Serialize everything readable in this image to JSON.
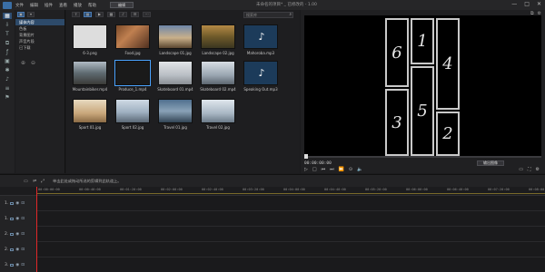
{
  "titlebar": {
    "menu": [
      "文件",
      "编辑",
      "插件",
      "查看",
      "播放",
      "帮助"
    ],
    "mode_button": "编辑",
    "window_title": "未命名的项目* _ 已修改的 - 1.00",
    "controls": [
      "—",
      "□",
      "✕"
    ]
  },
  "rail": {
    "icons": [
      "media-room-icon",
      "import-icon",
      "text-icon",
      "transition-icon",
      "fx-icon",
      "pip-icon",
      "particle-icon",
      "audio-icon",
      "subtitle-icon",
      "chapter-icon"
    ]
  },
  "tree": {
    "items": [
      "媒体内容",
      "色板",
      "背景图片",
      "声音片段",
      "已下载"
    ],
    "selected_index": 0
  },
  "library": {
    "search_placeholder": "搜索库",
    "items": [
      {
        "name": "6-3.png",
        "thumb": "t-collage",
        "type": "image"
      },
      {
        "name": "Food.jpg",
        "thumb": "t-food",
        "type": "image"
      },
      {
        "name": "Landscape 01.jpg",
        "thumb": "t-land1",
        "type": "image"
      },
      {
        "name": "Landscape 02.jpg",
        "thumb": "t-land2",
        "type": "image"
      },
      {
        "name": "Mahoroba.mp3",
        "thumb": "t-music",
        "type": "audio"
      },
      {
        "name": "Mountainbiker.mp4",
        "thumb": "t-mtb",
        "type": "video"
      },
      {
        "name": "Produce_1.mp4",
        "thumb": "t-prod",
        "type": "video"
      },
      {
        "name": "Skateboard 01.mp4",
        "thumb": "t-skate1",
        "type": "video"
      },
      {
        "name": "Skateboard 02.mp4",
        "thumb": "t-skate2",
        "type": "video"
      },
      {
        "name": "Speaking Out.mp3",
        "thumb": "t-music",
        "type": "audio"
      },
      {
        "name": "Sport 01.jpg",
        "thumb": "t-sport1",
        "type": "image"
      },
      {
        "name": "Sport 02.jpg",
        "thumb": "t-sport2",
        "type": "image"
      },
      {
        "name": "Travel 01.jpg",
        "thumb": "t-travel1",
        "type": "image"
      },
      {
        "name": "Travel 02.jpg",
        "thumb": "t-travel2",
        "type": "image"
      }
    ],
    "selected_index": 6
  },
  "preview": {
    "cells": [
      "6",
      "1",
      "4",
      "5",
      "3",
      "2"
    ],
    "timecode": "00:00:00:00",
    "button": "输出图像",
    "colors": {
      "cell_border": "#c9c9c9",
      "canvas": "#000000"
    }
  },
  "timeline": {
    "message": "单击此处或拖动所选的剪辑到此轨道上。",
    "ruler": [
      "00:00:00:00",
      "00:00:40:00",
      "00:01:20:00",
      "00:02:00:00",
      "00:02:40:00",
      "00:03:20:00",
      "00:04:00:00",
      "00:04:40:00",
      "00:05:20:00",
      "00:06:00:00",
      "00:06:40:00",
      "00:07:20:00",
      "00:08:00:00"
    ],
    "tracks": [
      "1.",
      "1.",
      "2.",
      "2.",
      "3."
    ],
    "colors": {
      "playhead": "#e02828",
      "accent": "#2e4e73"
    }
  }
}
